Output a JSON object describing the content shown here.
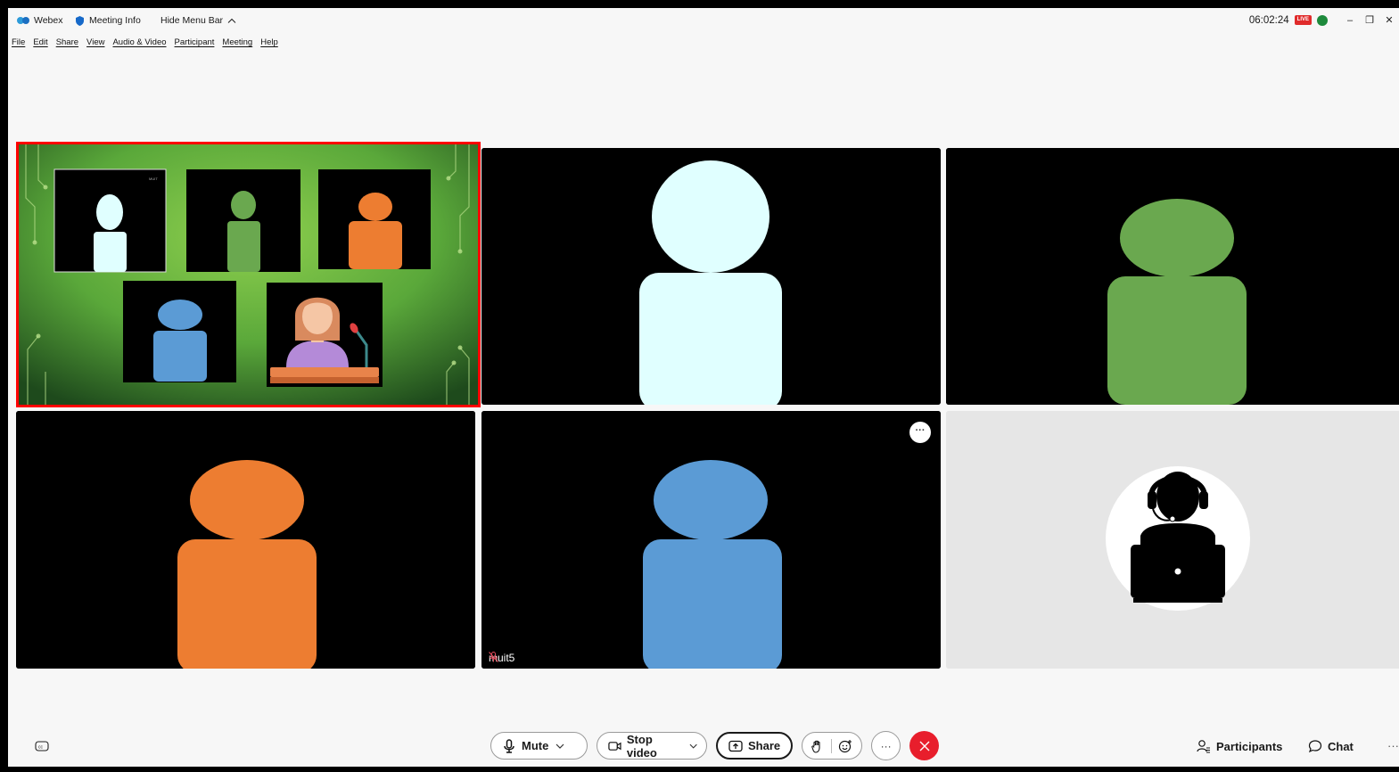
{
  "titlebar": {
    "app_name": "Webex",
    "meeting_info": "Meeting Info",
    "hide_menu_bar": "Hide Menu Bar",
    "clock": "06:02:24",
    "live_badge": "LIVE",
    "minimize": "–",
    "restore": "❐",
    "close": "✕"
  },
  "menubar": {
    "items": [
      "File",
      "Edit",
      "Share",
      "View",
      "Audio & Video",
      "Participant",
      "Meeting",
      "Help"
    ]
  },
  "tiles": [
    {
      "type": "shared-content-illustration",
      "highlighted": true,
      "highlight_color": "#ff0000",
      "mini_label": "MUIT"
    },
    {
      "type": "avatar",
      "color": "#e0ffff"
    },
    {
      "type": "avatar",
      "color": "#6aa84f"
    },
    {
      "type": "avatar",
      "color": "#ed7d31"
    },
    {
      "type": "avatar",
      "color": "#5b9bd5",
      "name": "muit5",
      "muted": true
    },
    {
      "type": "headset-user-avatar",
      "background": "#e6e6e6"
    }
  ],
  "controls": {
    "mute": "Mute",
    "stop_video": "Stop video",
    "share": "Share",
    "more": "···",
    "participants": "Participants",
    "chat": "Chat",
    "overflow": "···",
    "end_color": "#e81e2c"
  }
}
